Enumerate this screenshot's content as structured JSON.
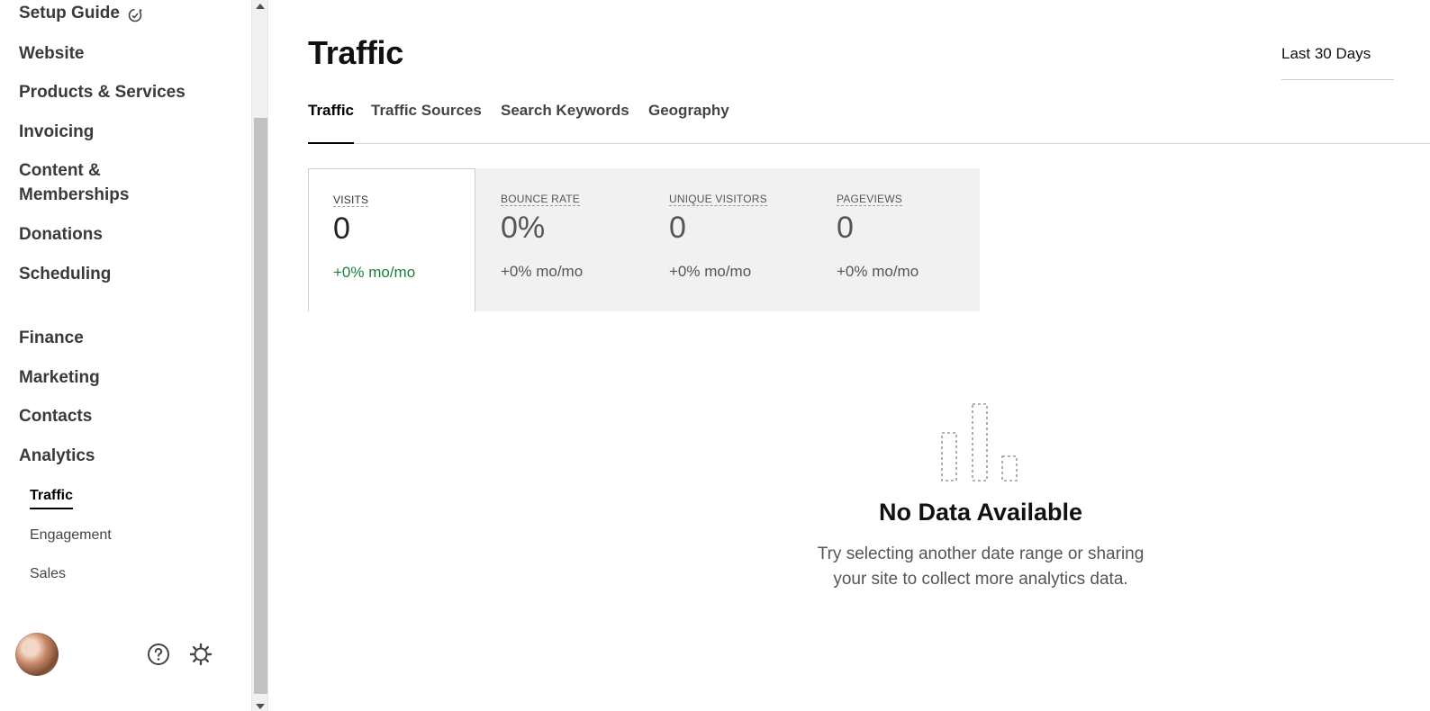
{
  "sidebar": {
    "items": [
      {
        "label": "Setup Guide"
      },
      {
        "label": "Website"
      },
      {
        "label": "Products & Services"
      },
      {
        "label": "Invoicing"
      },
      {
        "label": "Content & Memberships"
      },
      {
        "label": "Donations"
      },
      {
        "label": "Scheduling"
      },
      {
        "label": "Finance"
      },
      {
        "label": "Marketing"
      },
      {
        "label": "Contacts"
      },
      {
        "label": "Analytics"
      }
    ],
    "analytics_subitems": [
      {
        "label": "Traffic",
        "active": true
      },
      {
        "label": "Engagement",
        "active": false
      },
      {
        "label": "Sales",
        "active": false
      }
    ],
    "footer_icons": [
      "avatar",
      "help-icon",
      "gear-icon"
    ]
  },
  "main": {
    "title": "Traffic",
    "date_range": "Last 30 Days",
    "tabs": [
      {
        "label": "Traffic",
        "active": true
      },
      {
        "label": "Traffic Sources",
        "active": false
      },
      {
        "label": "Search Keywords",
        "active": false
      },
      {
        "label": "Geography",
        "active": false
      }
    ],
    "metrics": [
      {
        "label": "VISITS",
        "value": "0",
        "delta": "+0% mo/mo",
        "active": true
      },
      {
        "label": "BOUNCE RATE",
        "value": "0%",
        "delta": "+0% mo/mo",
        "active": false
      },
      {
        "label": "UNIQUE VISITORS",
        "value": "0",
        "delta": "+0% mo/mo",
        "active": false
      },
      {
        "label": "PAGEVIEWS",
        "value": "0",
        "delta": "+0% mo/mo",
        "active": false
      }
    ],
    "empty_state": {
      "icon": "bar-chart-icon",
      "title": "No Data Available",
      "line1": "Try selecting another date range or sharing",
      "line2": "your site to collect more analytics data."
    }
  },
  "colors": {
    "active_green": "#1b7f3b",
    "metrics_bg": "#f1f1f1",
    "text_muted": "#555555"
  }
}
